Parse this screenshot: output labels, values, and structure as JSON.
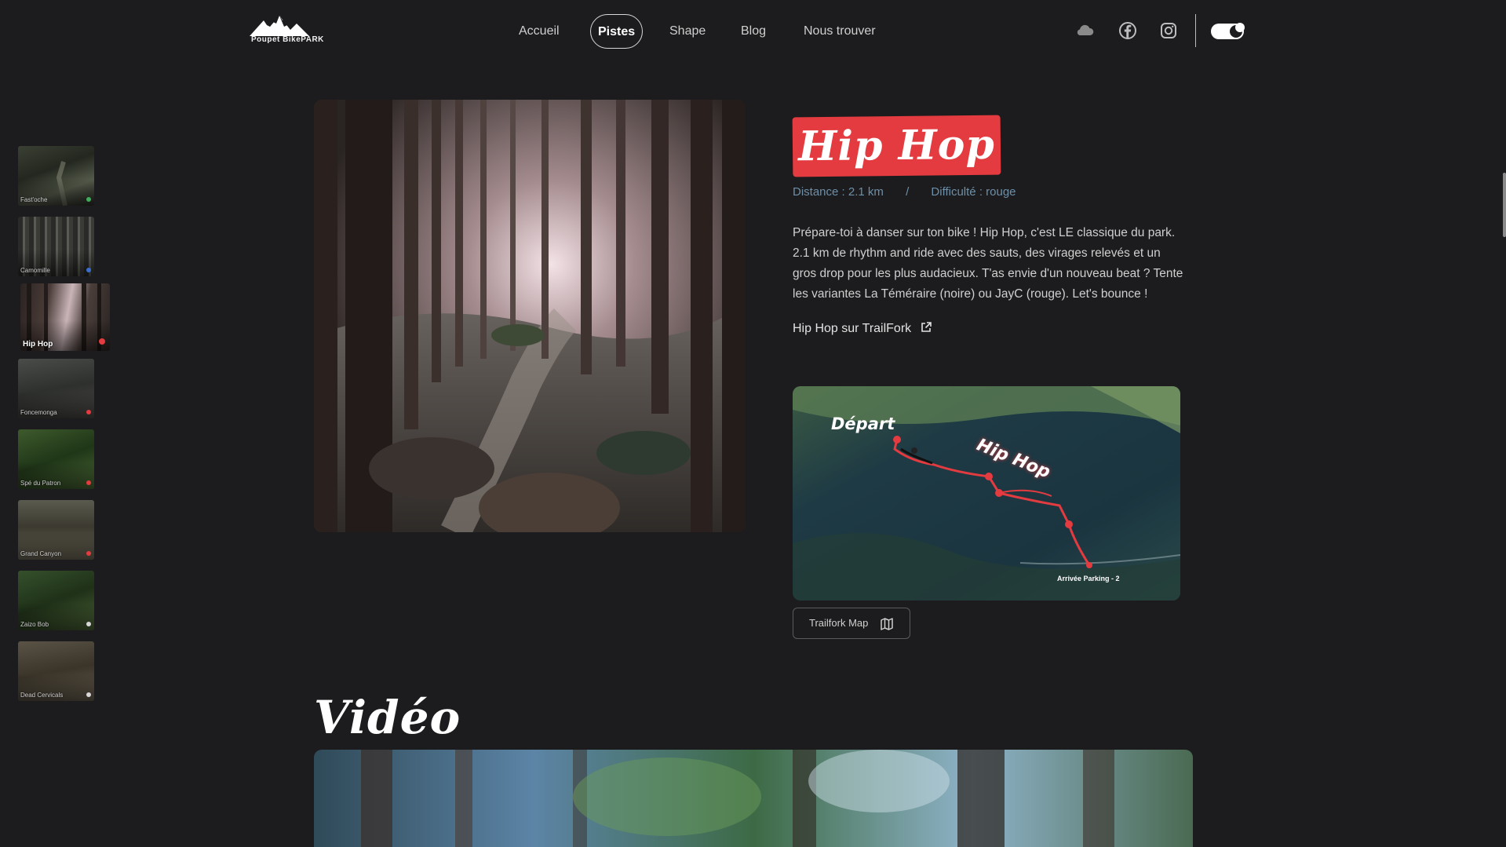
{
  "brand": {
    "logo_text": "Poupet BikePARK"
  },
  "nav": {
    "items": [
      {
        "label": "Accueil",
        "active": false
      },
      {
        "label": "Pistes",
        "active": true
      },
      {
        "label": "Shape",
        "active": false
      },
      {
        "label": "Blog",
        "active": false
      },
      {
        "label": "Nous trouver",
        "active": false
      }
    ]
  },
  "header_icons": [
    "cloud-icon",
    "facebook-icon",
    "instagram-icon"
  ],
  "theme_toggle": {
    "state": "dark"
  },
  "sidebar": {
    "trails": [
      {
        "name": "Fast'oche",
        "difficulty_color": "#3fae5a"
      },
      {
        "name": "Camomille",
        "difficulty_color": "#3a6fd0"
      },
      {
        "name": "Hip Hop",
        "difficulty_color": "#e33b3f",
        "active": true
      },
      {
        "name": "Foncemonga",
        "difficulty_color": "#e33b3f"
      },
      {
        "name": "Spé du Patron",
        "difficulty_color": "#e33b3f"
      },
      {
        "name": "Grand Canyon",
        "difficulty_color": "#e33b3f"
      },
      {
        "name": "Zaizo Bob",
        "difficulty_color": "#d8d8d8"
      },
      {
        "name": "Dead Cervicals",
        "difficulty_color": "#d8d8d8"
      }
    ]
  },
  "trail": {
    "title": "Hip Hop",
    "distance": "Distance : 2.1 km",
    "separator": "/",
    "difficulty": "Difficulté : rouge",
    "description": "Prépare-toi à danser sur ton bike ! Hip Hop, c'est LE classique du park. 2.1 km de rhythm and ride avec des sauts, des virages relevés et un gros drop pour les plus audacieux. T'as envie d'un nouveau beat ? Tente les variantes La Téméraire (noire) ou JayC (rouge). Let's bounce !",
    "trailfork_link": "Hip Hop sur TrailFork"
  },
  "map": {
    "label_start": "Départ",
    "label_trail": "Hip Hop",
    "label_end": "Arrivée Parking - 2",
    "button_label": "Trailfork Map"
  },
  "video": {
    "heading": "Vidéo"
  },
  "colors": {
    "accent": "#e33b3f",
    "background": "#1c1c1e",
    "meta": "#6d8fa8"
  }
}
